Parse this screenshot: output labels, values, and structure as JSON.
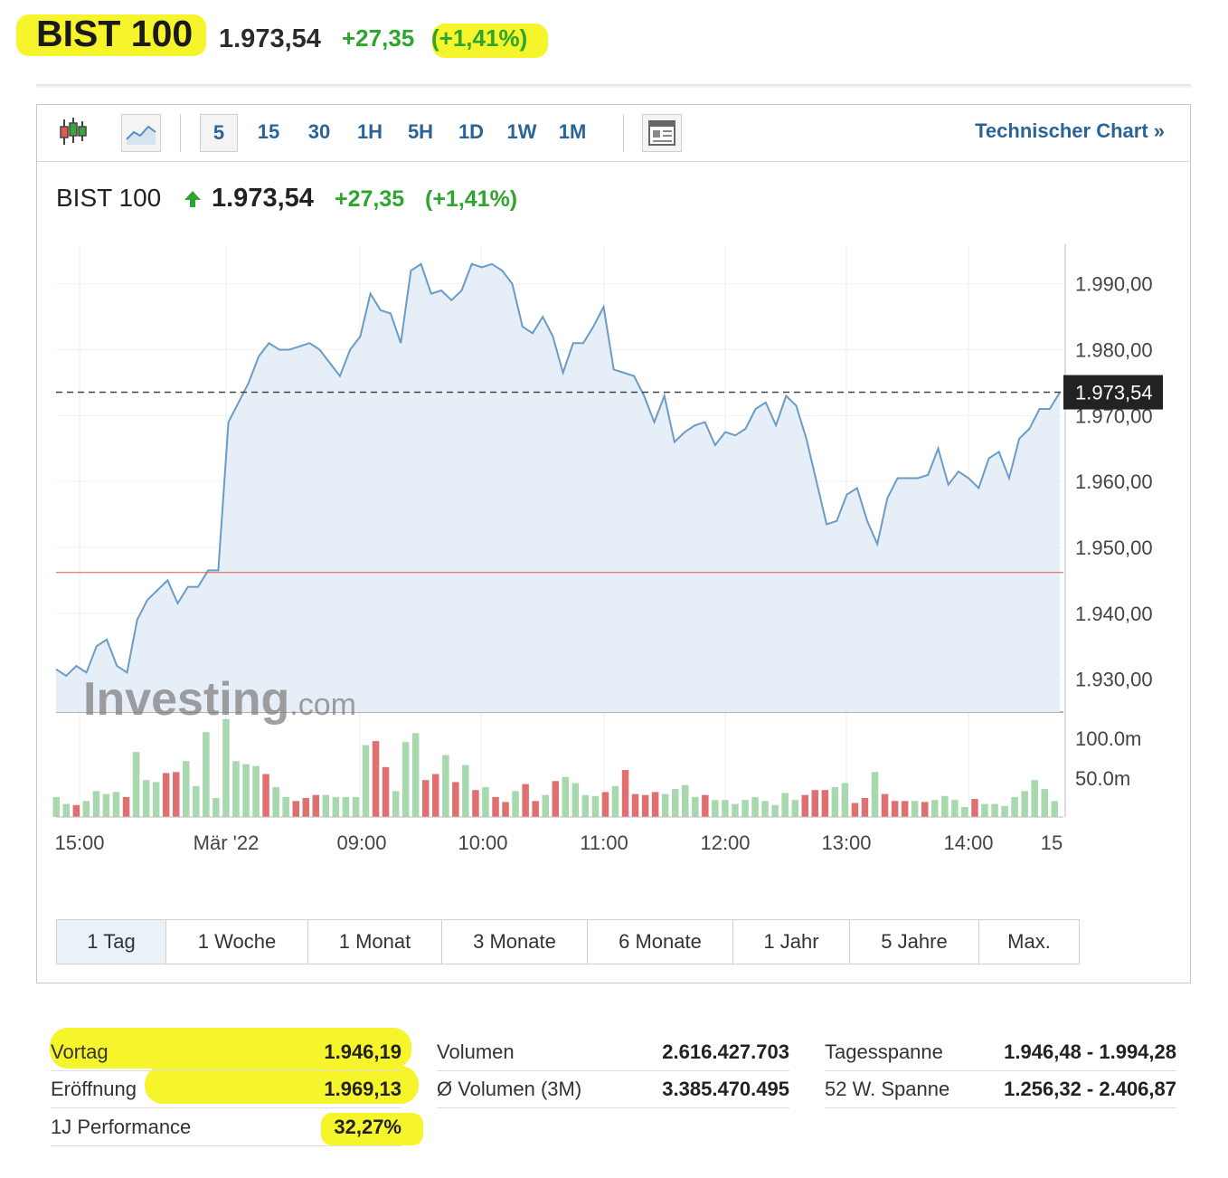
{
  "header": {
    "title": "BIST 100",
    "price": "1.973,54",
    "change": "+27,35",
    "change_pct": "(+1,41%)"
  },
  "toolbar": {
    "intervals": [
      "5",
      "15",
      "30",
      "1H",
      "5H",
      "1D",
      "1W",
      "1M"
    ],
    "active_interval": "5",
    "technical_chart_label": "Technischer Chart »",
    "icons": [
      "candlestick-chart-icon",
      "area-chart-icon",
      "news-layout-icon"
    ]
  },
  "chart_header": {
    "title": "BIST 100",
    "price": "1.973,54",
    "change": "+27,35",
    "change_pct": "(+1,41%)",
    "arrow": "up-arrow-icon"
  },
  "chart_data": {
    "type": "area",
    "y_ticks": [
      "1.990,00",
      "1.980,00",
      "1.970,00",
      "1.960,00",
      "1.950,00",
      "1.940,00",
      "1.930,00"
    ],
    "ylim": [
      1925,
      1996
    ],
    "x_tick_labels": [
      "15:00",
      "Mär '22",
      "09:00",
      "10:00",
      "11:00",
      "12:00",
      "13:00",
      "14:00",
      "15"
    ],
    "current_value_label": "1.973,54",
    "current_value": 1973.54,
    "previous_close": 1946.19,
    "watermark": "Investing.com",
    "values": [
      1931.5,
      1930.5,
      1932,
      1931,
      1935,
      1936,
      1932,
      1931,
      1939,
      1942,
      1943.5,
      1945,
      1941.5,
      1944,
      1944,
      1946.5,
      1946.5,
      1969,
      1972,
      1975,
      1979,
      1981,
      1980,
      1980,
      1980.5,
      1981,
      1980,
      1978,
      1976,
      1980,
      1982,
      1988.5,
      1986,
      1985.5,
      1981,
      1992,
      1993,
      1988.5,
      1989,
      1987.5,
      1989,
      1993,
      1992.5,
      1993,
      1992,
      1990,
      1983.5,
      1982.5,
      1985,
      1982,
      1976.5,
      1981,
      1981,
      1983.5,
      1986.5,
      1977,
      1976.5,
      1976,
      1973,
      1969,
      1973,
      1966,
      1967.5,
      1968.5,
      1969,
      1965.5,
      1967.5,
      1967,
      1968,
      1971,
      1972,
      1968.5,
      1973,
      1971.5,
      1966.5,
      1960,
      1953.5,
      1954,
      1958,
      1959,
      1954,
      1950.5,
      1957.5,
      1960.5,
      1960.5,
      1960.5,
      1961,
      1965,
      1959.5,
      1961.5,
      1960.5,
      1959,
      1963.5,
      1964.5,
      1960.5,
      1966.5,
      1968,
      1971,
      1971,
      1973.5
    ],
    "volume_ticks": [
      "100.0m",
      "50.0m"
    ],
    "volume_max": 125,
    "volumes": [
      20,
      13,
      12,
      16,
      26,
      23,
      25,
      20,
      65,
      37,
      35,
      44,
      45,
      56,
      31,
      85,
      19,
      98,
      56,
      53,
      51,
      43,
      30,
      20,
      16,
      19,
      22,
      22,
      20,
      20,
      20,
      72,
      76,
      50,
      26,
      75,
      84,
      37,
      43,
      62,
      35,
      52,
      27,
      30,
      20,
      15,
      26,
      33,
      16,
      22,
      36,
      40,
      34,
      22,
      21,
      25,
      31,
      47,
      23,
      22,
      25,
      23,
      28,
      32,
      20,
      22,
      17,
      17,
      13,
      17,
      20,
      16,
      12,
      24,
      17,
      22,
      27,
      27,
      30,
      34,
      14,
      19,
      45,
      23,
      16,
      16,
      16,
      15,
      17,
      21,
      17,
      10,
      18,
      13,
      13,
      11,
      20,
      26,
      37,
      28,
      16
    ],
    "volume_colors": [
      "g",
      "g",
      "r",
      "g",
      "g",
      "g",
      "g",
      "r",
      "g",
      "g",
      "g",
      "r",
      "r",
      "g",
      "g",
      "g",
      "g",
      "g",
      "g",
      "g",
      "g",
      "r",
      "g",
      "g",
      "r",
      "r",
      "r",
      "g",
      "g",
      "g",
      "g",
      "g",
      "r",
      "r",
      "g",
      "g",
      "g",
      "r",
      "r",
      "g",
      "r",
      "g",
      "r",
      "g",
      "r",
      "r",
      "g",
      "r",
      "r",
      "g",
      "r",
      "g",
      "g",
      "g",
      "g",
      "r",
      "g",
      "r",
      "r",
      "r",
      "r",
      "g",
      "g",
      "g",
      "g",
      "r",
      "g",
      "g",
      "g",
      "g",
      "g",
      "g",
      "g",
      "g",
      "g",
      "r",
      "r",
      "r",
      "g",
      "g",
      "r",
      "r",
      "g",
      "r",
      "r",
      "r",
      "g",
      "r",
      "g",
      "g",
      "g",
      "g",
      "r",
      "g",
      "g",
      "g",
      "g",
      "g",
      "g",
      "g",
      "g"
    ]
  },
  "time_ranges": {
    "items": [
      "1 Tag",
      "1 Woche",
      "1 Monat",
      "3 Monate",
      "6 Monate",
      "1 Jahr",
      "5 Jahre",
      "Max."
    ],
    "active": "1 Tag"
  },
  "stats": {
    "col1": [
      {
        "label": "Vortag",
        "value": "1.946,19"
      },
      {
        "label": "Eröffnung",
        "value": "1.969,13"
      },
      {
        "label": "1J Performance",
        "value": "32,27%"
      }
    ],
    "col2": [
      {
        "label": "Volumen",
        "value": "2.616.427.703"
      },
      {
        "label": "Ø Volumen (3M)",
        "value": "3.385.470.495"
      }
    ],
    "col3": [
      {
        "label": "Tagesspanne",
        "value": "1.946,48 - 1.994,28"
      },
      {
        "label": "52 W. Spanne",
        "value": "1.256,32 - 2.406,87"
      }
    ]
  },
  "colors": {
    "highlight": "#f6f42a",
    "positive": "#2ea52e",
    "link": "#2a6496",
    "line": "#6a9cc7",
    "area": "#e6eef7",
    "volume_up": "#a8d8ad",
    "volume_down": "#e07070",
    "previous_close_line": "#e05a4f"
  }
}
